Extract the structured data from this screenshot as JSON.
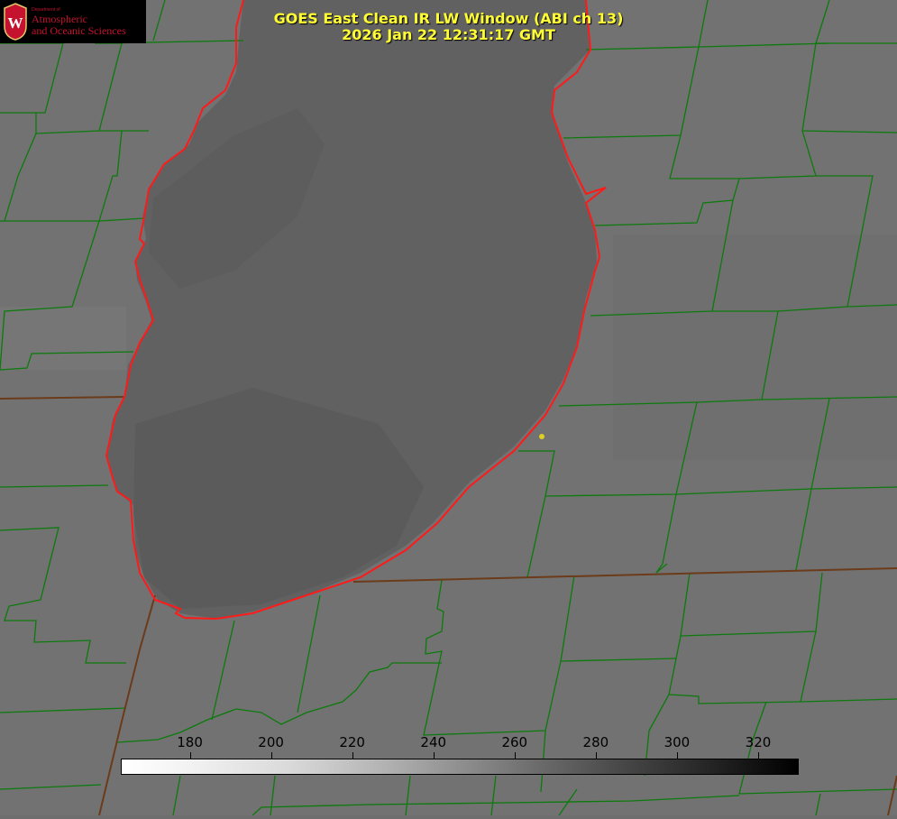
{
  "header": {
    "title_line1": "GOES East Clean IR LW Window (ABI ch 13)",
    "title_line2": "2026 Jan 22 12:31:17 GMT"
  },
  "logo": {
    "dept_small": "Department of",
    "line1": "Atmospheric",
    "line2": "and Oceanic Sciences",
    "seal_letter": "W"
  },
  "colorbar": {
    "ticks": [
      "180",
      "200",
      "220",
      "240",
      "260",
      "280",
      "300",
      "320"
    ],
    "min_value": 163,
    "max_value": 330
  },
  "colors": {
    "county_lines": "#0c7a0c",
    "shoreline": "#ff1a1a",
    "title_text": "#ffff33",
    "logo_text": "#c4122f",
    "marker": "#e0d020"
  }
}
